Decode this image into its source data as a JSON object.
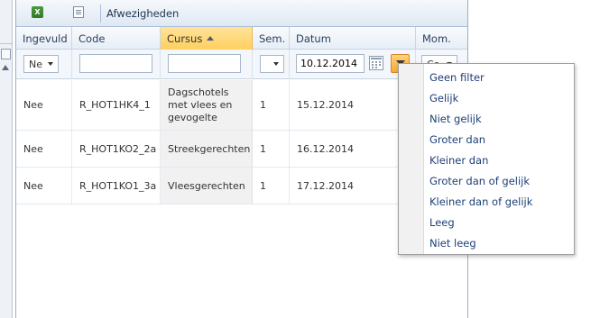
{
  "toolbar": {
    "export_excel_icon": "excel-icon",
    "export_doc_icon": "document-icon",
    "absences_label": "Afwezigheden"
  },
  "columns": {
    "ingevuld": "Ingevuld",
    "code": "Code",
    "cursus": "Cursus",
    "sem": "Sem.",
    "datum": "Datum",
    "mom": "Mom."
  },
  "sort": {
    "column": "Cursus",
    "direction": "ascending"
  },
  "filters": {
    "ingevuld_value": "Ne",
    "code_value": "",
    "cursus_value": "",
    "sem_value": "",
    "datum_value": "10.12.2014",
    "mom_value": "Co"
  },
  "rows": [
    {
      "ingevuld": "Nee",
      "code": "R_HOT1HK4_1",
      "cursus": "Dagschotels met vlees en gevogelte",
      "sem": "1",
      "datum": "15.12.2014"
    },
    {
      "ingevuld": "Nee",
      "code": "R_HOT1KO2_2a",
      "cursus": "Streekgerechten",
      "sem": "1",
      "datum": "16.12.2014"
    },
    {
      "ingevuld": "Nee",
      "code": "R_HOT1KO1_3a",
      "cursus": "Vleesgerechten",
      "sem": "1",
      "datum": "17.12.2014"
    }
  ],
  "filter_menu": {
    "items": [
      "Geen filter",
      "Gelijk",
      "Niet gelijk",
      "Groter dan",
      "Kleiner dan",
      "Groter dan of gelijk",
      "Kleiner dan of gelijk",
      "Leeg",
      "Niet leeg"
    ]
  },
  "colors": {
    "sorted_header": "#ffcf5f",
    "active_filter_button": "#f6a935",
    "menu_text": "#1d3f78"
  }
}
